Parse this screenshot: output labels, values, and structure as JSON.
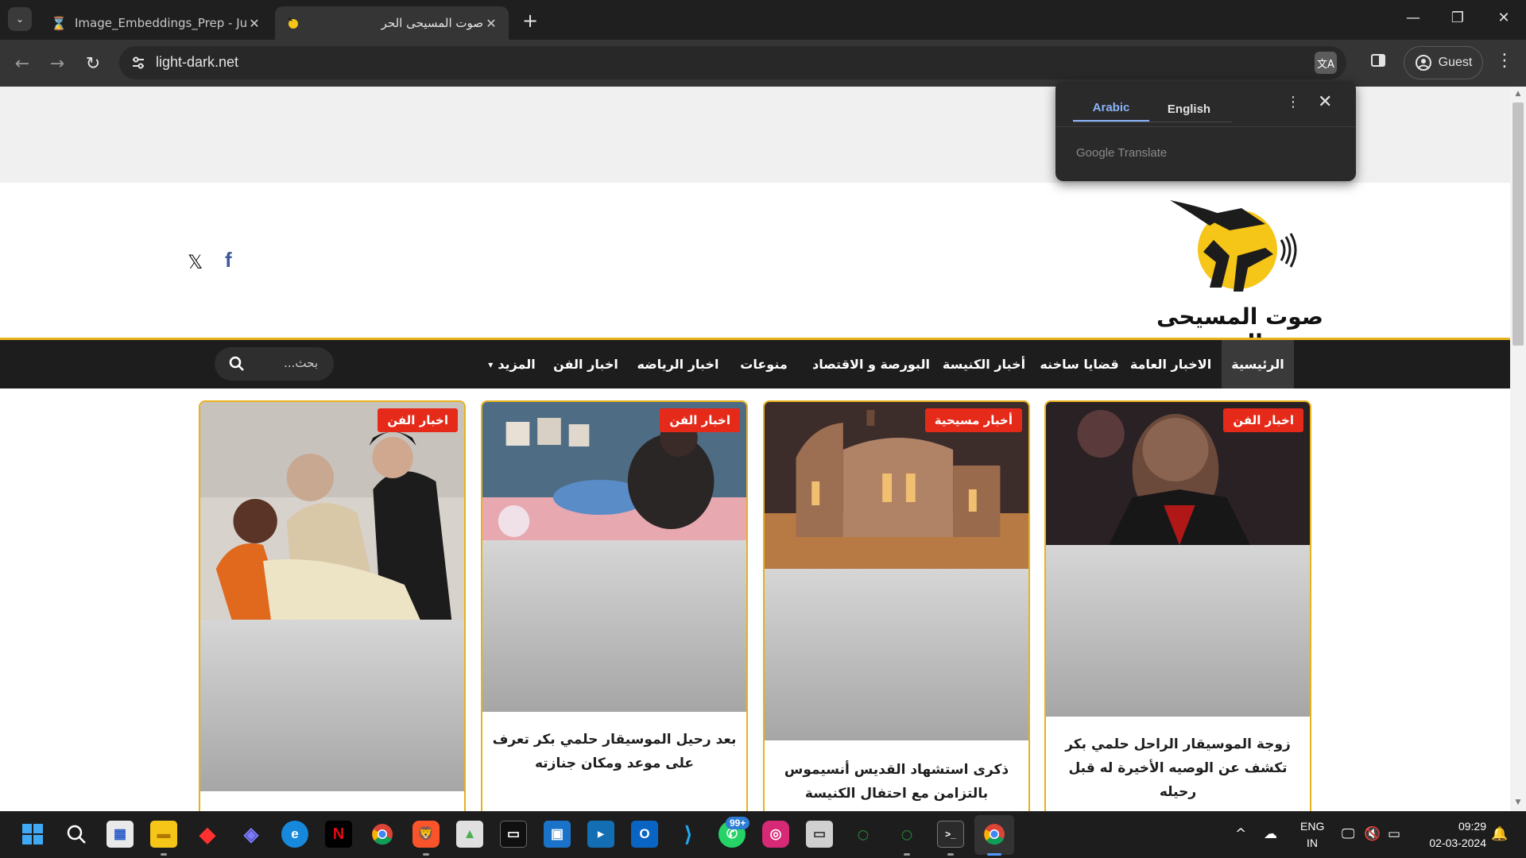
{
  "browser": {
    "tabs": [
      {
        "title": "Image_Embeddings_Prep - Jupy",
        "favicon": "hourglass-icon",
        "active": false
      },
      {
        "title": "صوت المسيحى الحر",
        "favicon": "site-favicon",
        "active": true
      }
    ],
    "url": "light-dark.net",
    "profile_label": "Guest"
  },
  "translate_popup": {
    "tabs": [
      "Arabic",
      "English"
    ],
    "active_tab": "Arabic",
    "brand": "Google Translate"
  },
  "site": {
    "logo_text": "صوت المسيحى الحر",
    "social": {
      "x_label": "𝕏",
      "facebook_label": "f"
    },
    "nav": {
      "items": [
        "الرئيسية",
        "الاخبار العامة",
        "قضايا ساخنه",
        "أخبار الكنيسة",
        "البورصة و الاقتصاد",
        "منوعات",
        "اخبار الرياضه",
        "اخبار الفن",
        "المزيد"
      ],
      "active_index": 0,
      "search_placeholder": "بحث..."
    },
    "cards": [
      {
        "badge": "اخبار الفن",
        "title": "زوجة الموسيقار الراحل حلمي بكر تكشف عن الوصيه الأخيرة له قبل رحيله"
      },
      {
        "badge": "أخبار مسيحية",
        "title": "ذكرى استشهاد القديس أنسيموس بالتزامن مع احتفال الكنيسة"
      },
      {
        "badge": "اخبار الفن",
        "title": "بعد رحيل الموسيقار حلمي بكر تعرف على موعد ومكان جنازته"
      },
      {
        "badge": "اخبار الفن",
        "title": ""
      }
    ]
  },
  "taskbar": {
    "whatsapp_badge": "99+",
    "language": "ENG",
    "region": "IN",
    "time": "09:29",
    "date": "02-03-2024"
  }
}
